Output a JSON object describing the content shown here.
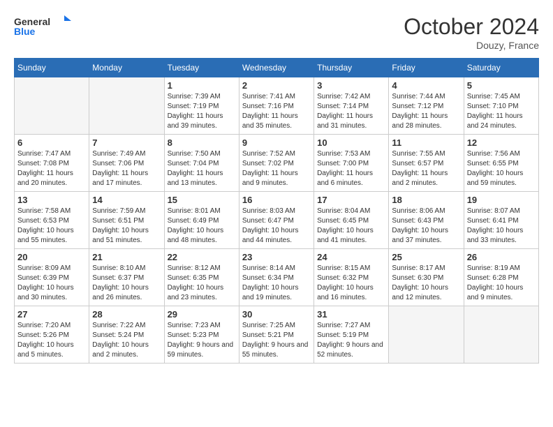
{
  "header": {
    "logo_general": "General",
    "logo_blue": "Blue",
    "month_title": "October 2024",
    "location": "Douzy, France"
  },
  "weekdays": [
    "Sunday",
    "Monday",
    "Tuesday",
    "Wednesday",
    "Thursday",
    "Friday",
    "Saturday"
  ],
  "weeks": [
    [
      {
        "day": "",
        "sunrise": "",
        "sunset": "",
        "daylight": ""
      },
      {
        "day": "",
        "sunrise": "",
        "sunset": "",
        "daylight": ""
      },
      {
        "day": "1",
        "sunrise": "Sunrise: 7:39 AM",
        "sunset": "Sunset: 7:19 PM",
        "daylight": "Daylight: 11 hours and 39 minutes."
      },
      {
        "day": "2",
        "sunrise": "Sunrise: 7:41 AM",
        "sunset": "Sunset: 7:16 PM",
        "daylight": "Daylight: 11 hours and 35 minutes."
      },
      {
        "day": "3",
        "sunrise": "Sunrise: 7:42 AM",
        "sunset": "Sunset: 7:14 PM",
        "daylight": "Daylight: 11 hours and 31 minutes."
      },
      {
        "day": "4",
        "sunrise": "Sunrise: 7:44 AM",
        "sunset": "Sunset: 7:12 PM",
        "daylight": "Daylight: 11 hours and 28 minutes."
      },
      {
        "day": "5",
        "sunrise": "Sunrise: 7:45 AM",
        "sunset": "Sunset: 7:10 PM",
        "daylight": "Daylight: 11 hours and 24 minutes."
      }
    ],
    [
      {
        "day": "6",
        "sunrise": "Sunrise: 7:47 AM",
        "sunset": "Sunset: 7:08 PM",
        "daylight": "Daylight: 11 hours and 20 minutes."
      },
      {
        "day": "7",
        "sunrise": "Sunrise: 7:49 AM",
        "sunset": "Sunset: 7:06 PM",
        "daylight": "Daylight: 11 hours and 17 minutes."
      },
      {
        "day": "8",
        "sunrise": "Sunrise: 7:50 AM",
        "sunset": "Sunset: 7:04 PM",
        "daylight": "Daylight: 11 hours and 13 minutes."
      },
      {
        "day": "9",
        "sunrise": "Sunrise: 7:52 AM",
        "sunset": "Sunset: 7:02 PM",
        "daylight": "Daylight: 11 hours and 9 minutes."
      },
      {
        "day": "10",
        "sunrise": "Sunrise: 7:53 AM",
        "sunset": "Sunset: 7:00 PM",
        "daylight": "Daylight: 11 hours and 6 minutes."
      },
      {
        "day": "11",
        "sunrise": "Sunrise: 7:55 AM",
        "sunset": "Sunset: 6:57 PM",
        "daylight": "Daylight: 11 hours and 2 minutes."
      },
      {
        "day": "12",
        "sunrise": "Sunrise: 7:56 AM",
        "sunset": "Sunset: 6:55 PM",
        "daylight": "Daylight: 10 hours and 59 minutes."
      }
    ],
    [
      {
        "day": "13",
        "sunrise": "Sunrise: 7:58 AM",
        "sunset": "Sunset: 6:53 PM",
        "daylight": "Daylight: 10 hours and 55 minutes."
      },
      {
        "day": "14",
        "sunrise": "Sunrise: 7:59 AM",
        "sunset": "Sunset: 6:51 PM",
        "daylight": "Daylight: 10 hours and 51 minutes."
      },
      {
        "day": "15",
        "sunrise": "Sunrise: 8:01 AM",
        "sunset": "Sunset: 6:49 PM",
        "daylight": "Daylight: 10 hours and 48 minutes."
      },
      {
        "day": "16",
        "sunrise": "Sunrise: 8:03 AM",
        "sunset": "Sunset: 6:47 PM",
        "daylight": "Daylight: 10 hours and 44 minutes."
      },
      {
        "day": "17",
        "sunrise": "Sunrise: 8:04 AM",
        "sunset": "Sunset: 6:45 PM",
        "daylight": "Daylight: 10 hours and 41 minutes."
      },
      {
        "day": "18",
        "sunrise": "Sunrise: 8:06 AM",
        "sunset": "Sunset: 6:43 PM",
        "daylight": "Daylight: 10 hours and 37 minutes."
      },
      {
        "day": "19",
        "sunrise": "Sunrise: 8:07 AM",
        "sunset": "Sunset: 6:41 PM",
        "daylight": "Daylight: 10 hours and 33 minutes."
      }
    ],
    [
      {
        "day": "20",
        "sunrise": "Sunrise: 8:09 AM",
        "sunset": "Sunset: 6:39 PM",
        "daylight": "Daylight: 10 hours and 30 minutes."
      },
      {
        "day": "21",
        "sunrise": "Sunrise: 8:10 AM",
        "sunset": "Sunset: 6:37 PM",
        "daylight": "Daylight: 10 hours and 26 minutes."
      },
      {
        "day": "22",
        "sunrise": "Sunrise: 8:12 AM",
        "sunset": "Sunset: 6:35 PM",
        "daylight": "Daylight: 10 hours and 23 minutes."
      },
      {
        "day": "23",
        "sunrise": "Sunrise: 8:14 AM",
        "sunset": "Sunset: 6:34 PM",
        "daylight": "Daylight: 10 hours and 19 minutes."
      },
      {
        "day": "24",
        "sunrise": "Sunrise: 8:15 AM",
        "sunset": "Sunset: 6:32 PM",
        "daylight": "Daylight: 10 hours and 16 minutes."
      },
      {
        "day": "25",
        "sunrise": "Sunrise: 8:17 AM",
        "sunset": "Sunset: 6:30 PM",
        "daylight": "Daylight: 10 hours and 12 minutes."
      },
      {
        "day": "26",
        "sunrise": "Sunrise: 8:19 AM",
        "sunset": "Sunset: 6:28 PM",
        "daylight": "Daylight: 10 hours and 9 minutes."
      }
    ],
    [
      {
        "day": "27",
        "sunrise": "Sunrise: 7:20 AM",
        "sunset": "Sunset: 5:26 PM",
        "daylight": "Daylight: 10 hours and 5 minutes."
      },
      {
        "day": "28",
        "sunrise": "Sunrise: 7:22 AM",
        "sunset": "Sunset: 5:24 PM",
        "daylight": "Daylight: 10 hours and 2 minutes."
      },
      {
        "day": "29",
        "sunrise": "Sunrise: 7:23 AM",
        "sunset": "Sunset: 5:23 PM",
        "daylight": "Daylight: 9 hours and 59 minutes."
      },
      {
        "day": "30",
        "sunrise": "Sunrise: 7:25 AM",
        "sunset": "Sunset: 5:21 PM",
        "daylight": "Daylight: 9 hours and 55 minutes."
      },
      {
        "day": "31",
        "sunrise": "Sunrise: 7:27 AM",
        "sunset": "Sunset: 5:19 PM",
        "daylight": "Daylight: 9 hours and 52 minutes."
      },
      {
        "day": "",
        "sunrise": "",
        "sunset": "",
        "daylight": ""
      },
      {
        "day": "",
        "sunrise": "",
        "sunset": "",
        "daylight": ""
      }
    ]
  ]
}
